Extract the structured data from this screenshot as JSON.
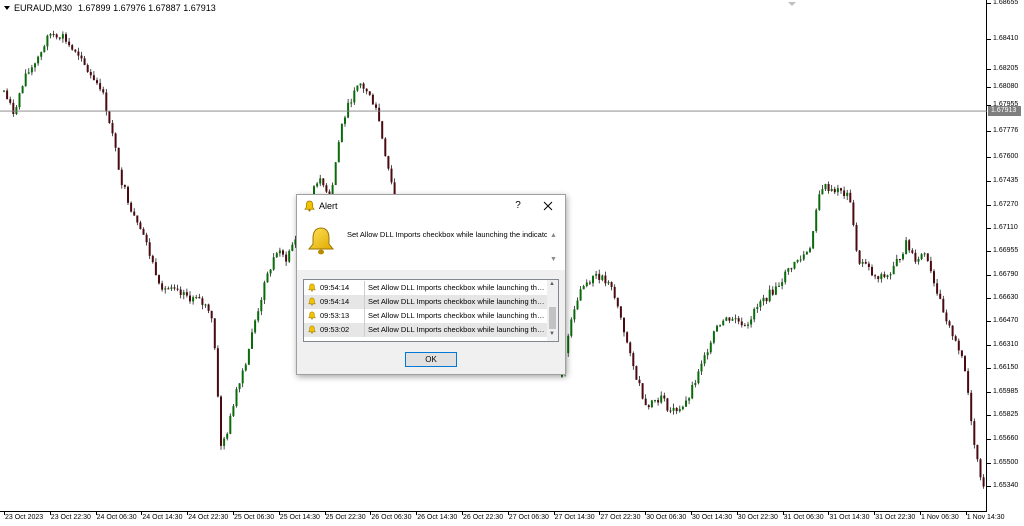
{
  "chart": {
    "symbol": "EURAUD,M30",
    "open": "1.67899",
    "high": "1.67976",
    "low": "1.67887",
    "close": "1.67913",
    "current_price_label": "1.67913",
    "current_price": 1.67913,
    "colors": {
      "bull": "#0a6b0a",
      "bear": "#4a0a10",
      "grid": "#e8e8e8",
      "price_line": "#808080"
    }
  },
  "chart_data": {
    "type": "candlestick",
    "ylim": [
      1.65325,
      1.68655
    ],
    "ticks": [
      "1.68655",
      "1.68410",
      "1.68205",
      "1.68080",
      "1.67955",
      "1.67776",
      "1.67600",
      "1.67435",
      "1.67270",
      "1.67110",
      "1.66955",
      "1.66790",
      "1.66630",
      "1.66470",
      "1.66310",
      "1.66150",
      "1.65985",
      "1.65825",
      "1.65660",
      "1.65500",
      "1.65340"
    ],
    "x_labels": [
      "23 Oct 2023",
      "23 Oct 22:30",
      "24 Oct 06:30",
      "24 Oct 14:30",
      "24 Oct 22:30",
      "25 Oct 06:30",
      "25 Oct 14:30",
      "25 Oct 22:30",
      "26 Oct 06:30",
      "26 Oct 14:30",
      "26 Oct 22:30",
      "27 Oct 06:30",
      "27 Oct 14:30",
      "27 Oct 22:30",
      "30 Oct 06:30",
      "30 Oct 14:30",
      "30 Oct 22:30",
      "31 Oct 06:30",
      "31 Oct 14:30",
      "31 Oct 22:30",
      "1 Nov 06:30",
      "1 Nov 14:30"
    ],
    "path": [
      [
        0,
        1.681
      ],
      [
        12,
        1.679
      ],
      [
        25,
        1.6815
      ],
      [
        38,
        1.683
      ],
      [
        50,
        1.6845
      ],
      [
        62,
        1.6843
      ],
      [
        75,
        1.683
      ],
      [
        88,
        1.6818
      ],
      [
        100,
        1.6808
      ],
      [
        110,
        1.678
      ],
      [
        120,
        1.6745
      ],
      [
        130,
        1.6725
      ],
      [
        140,
        1.6712
      ],
      [
        150,
        1.669
      ],
      [
        160,
        1.6672
      ],
      [
        170,
        1.6668
      ],
      [
        180,
        1.6665
      ],
      [
        195,
        1.6662
      ],
      [
        210,
        1.6655
      ],
      [
        215,
        1.662
      ],
      [
        220,
        1.656
      ],
      [
        228,
        1.6575
      ],
      [
        235,
        1.66
      ],
      [
        245,
        1.662
      ],
      [
        255,
        1.665
      ],
      [
        265,
        1.6675
      ],
      [
        275,
        1.6695
      ],
      [
        285,
        1.669
      ],
      [
        300,
        1.6712
      ],
      [
        315,
        1.6745
      ],
      [
        330,
        1.6735
      ],
      [
        340,
        1.678
      ],
      [
        350,
        1.68
      ],
      [
        360,
        1.681
      ],
      [
        375,
        1.6795
      ],
      [
        385,
        1.676
      ],
      [
        395,
        1.673
      ],
      [
        560,
        1.6605
      ],
      [
        570,
        1.665
      ],
      [
        580,
        1.667
      ],
      [
        595,
        1.668
      ],
      [
        610,
        1.667
      ],
      [
        620,
        1.665
      ],
      [
        630,
        1.662
      ],
      [
        645,
        1.659
      ],
      [
        660,
        1.6595
      ],
      [
        670,
        1.6585
      ],
      [
        685,
        1.659
      ],
      [
        700,
        1.6615
      ],
      [
        715,
        1.6645
      ],
      [
        730,
        1.665
      ],
      [
        745,
        1.6645
      ],
      [
        760,
        1.666
      ],
      [
        775,
        1.667
      ],
      [
        790,
        1.6685
      ],
      [
        800,
        1.669
      ],
      [
        810,
        1.67
      ],
      [
        820,
        1.674
      ],
      [
        832,
        1.6738
      ],
      [
        842,
        1.6735
      ],
      [
        850,
        1.673
      ],
      [
        856,
        1.669
      ],
      [
        865,
        1.6685
      ],
      [
        875,
        1.6675
      ],
      [
        890,
        1.668
      ],
      [
        905,
        1.67
      ],
      [
        915,
        1.669
      ],
      [
        925,
        1.6695
      ],
      [
        935,
        1.667
      ],
      [
        945,
        1.6645
      ],
      [
        955,
        1.6635
      ],
      [
        965,
        1.661
      ],
      [
        972,
        1.657
      ],
      [
        978,
        1.6545
      ],
      [
        983,
        1.6535
      ],
      [
        986,
        1.6538
      ]
    ]
  },
  "alert": {
    "title": "Alert",
    "help_label": "?",
    "message": "Set Allow DLL Imports checkbox while launching the indicator",
    "history": [
      {
        "time": "09:54:14",
        "text": "Set Allow DLL Imports checkbox while launching the indicator"
      },
      {
        "time": "09:54:14",
        "text": "Set Allow DLL Imports checkbox while launching the indicator"
      },
      {
        "time": "09:53:13",
        "text": "Set Allow DLL Imports checkbox while launching the indicator"
      },
      {
        "time": "09:53:02",
        "text": "Set Allow DLL Imports checkbox while launching the indicator"
      }
    ],
    "ok_label": "OK"
  }
}
